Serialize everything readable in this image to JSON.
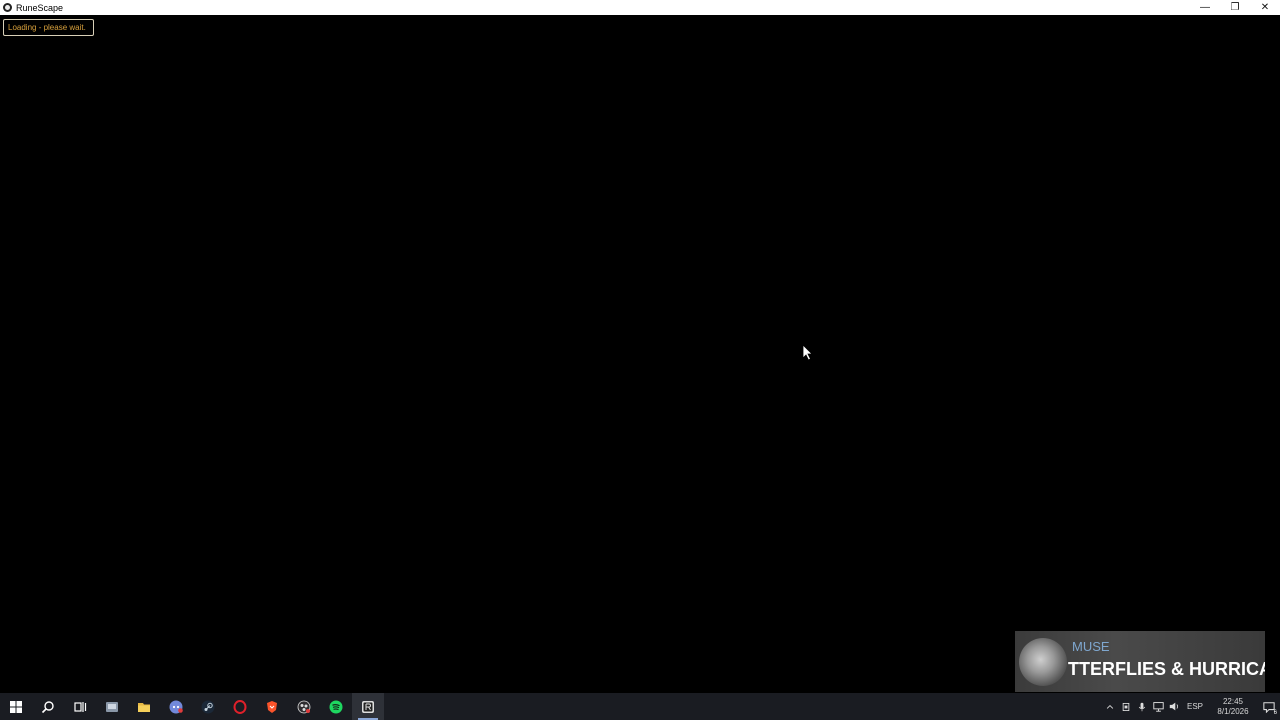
{
  "window": {
    "title": "RuneScape",
    "minimize_glyph": "—",
    "restore_glyph": "❐",
    "close_glyph": "✕"
  },
  "game": {
    "loading_text": "Loading - please wait."
  },
  "now_playing": {
    "artist": "MUSE",
    "track": "TTERFLIES & HURRICA"
  },
  "taskbar": {
    "apps": [
      {
        "name": "start-icon"
      },
      {
        "name": "search-icon"
      },
      {
        "name": "task-view-icon"
      },
      {
        "name": "app-icon"
      },
      {
        "name": "file-explorer-icon"
      },
      {
        "name": "discord-icon"
      },
      {
        "name": "steam-icon"
      },
      {
        "name": "opera-icon"
      },
      {
        "name": "brave-icon"
      },
      {
        "name": "obs-icon"
      },
      {
        "name": "spotify-icon"
      },
      {
        "name": "runescape-icon",
        "active": true
      }
    ],
    "language": "ESP",
    "time": "22:45",
    "date": "8/1/2026",
    "notification_count": "6"
  },
  "colors": {
    "loading_text": "#d7a03c",
    "taskbar_bg": "#1a1c22",
    "artist_text": "#7fa7cf"
  }
}
